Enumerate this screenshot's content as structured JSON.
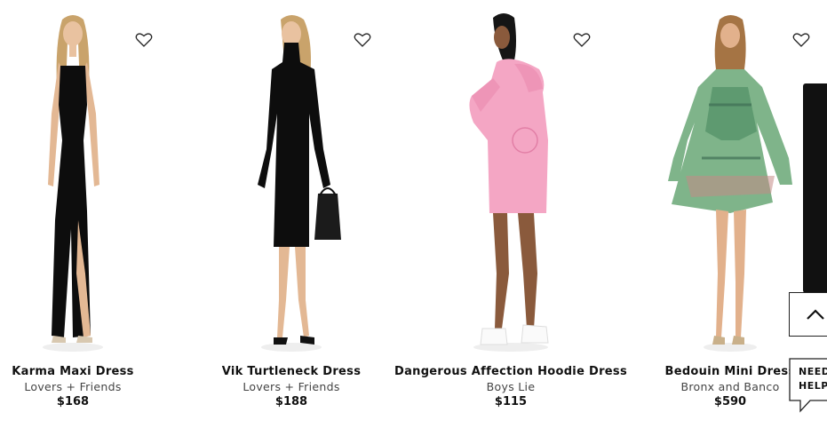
{
  "products": [
    {
      "name": "Karma Maxi Dress",
      "brand": "Lovers + Friends",
      "price": "$168",
      "image": "black-maxi-dress"
    },
    {
      "name": "Vik Turtleneck Dress",
      "brand": "Lovers + Friends",
      "price": "$188",
      "image": "black-turtleneck-dress"
    },
    {
      "name": "Dangerous Affection Hoodie Dress",
      "brand": "Boys Lie",
      "price": "$115",
      "image": "pink-hoodie-dress"
    },
    {
      "name": "Bedouin Mini Dress",
      "brand": "Bronx and Banco",
      "price": "$590",
      "image": "green-print-mini-dress"
    }
  ],
  "help": {
    "line1": "NEED",
    "line2": "HELP"
  },
  "icons": {
    "wishlist": "heart-outline-icon",
    "back_to_top": "chevron-up-icon"
  },
  "colors": {
    "background": "#ffffff",
    "text": "#111111",
    "panel": "#111111"
  }
}
